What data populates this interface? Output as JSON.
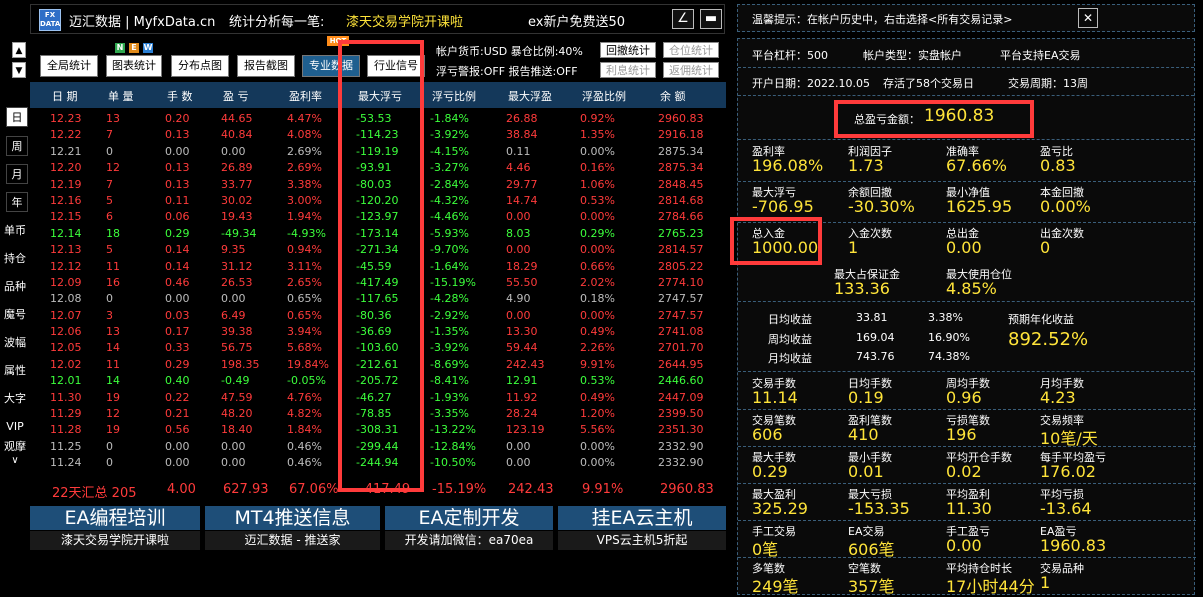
{
  "title_bar": {
    "brand": "迈汇数据 | MyfxData.cn",
    "slogan": "统计分析每一笔:",
    "promo": "漆天交易学院开课啦",
    "promo2": "ex新户免费送50",
    "min_icon": "∠",
    "close_icon": "▬"
  },
  "sidebar": {
    "arrow_up": "▲",
    "arrow_down": "▼",
    "nav": [
      "日",
      "周",
      "月",
      "年"
    ],
    "menu": [
      "单币",
      "持仓",
      "品种",
      "魔号",
      "波幅",
      "属性",
      "大字",
      "VIP",
      "观摩"
    ],
    "more": "∨"
  },
  "toolbar": {
    "buttons": [
      "全局统计",
      "图表统计",
      "分布点图",
      "报告截图",
      "专业数据",
      "行业信号"
    ],
    "new_badge": "NEW",
    "hot_badge": "HOT"
  },
  "account_info": {
    "line1": "帐户货币:USD 暴仓比例:40%",
    "line2": "浮亏警报:OFF 报告推送:OFF",
    "btn_withdraw": "回撤统计",
    "btn_position": "仓位统计",
    "btn_interest": "利息统计",
    "btn_rebate": "返佣统计"
  },
  "table": {
    "headers": [
      "日 期",
      "单 量",
      "手 数",
      "盈 亏",
      "盈利率",
      "最大浮亏",
      "浮亏比例",
      "最大浮盈",
      "浮盈比例",
      "余 额"
    ],
    "rows": [
      [
        "12.23",
        "13",
        "0.20",
        "44.65",
        "4.47%",
        "-53.53",
        "-1.84%",
        "26.88",
        "0.92%",
        "2960.83",
        "r"
      ],
      [
        "12.22",
        "7",
        "0.13",
        "40.84",
        "4.08%",
        "-114.23",
        "-3.92%",
        "38.84",
        "1.35%",
        "2916.18",
        "r"
      ],
      [
        "12.21",
        "0",
        "0.00",
        "0.00",
        "2.69%",
        "-119.19",
        "-4.15%",
        "0.11",
        "0.00%",
        "2875.34",
        "n"
      ],
      [
        "12.20",
        "12",
        "0.13",
        "26.89",
        "2.69%",
        "-93.91",
        "-3.27%",
        "4.46",
        "0.16%",
        "2875.34",
        "r"
      ],
      [
        "12.19",
        "7",
        "0.13",
        "33.77",
        "3.38%",
        "-80.03",
        "-2.84%",
        "29.77",
        "1.06%",
        "2848.45",
        "r"
      ],
      [
        "12.16",
        "5",
        "0.11",
        "30.02",
        "3.00%",
        "-120.20",
        "-4.32%",
        "14.74",
        "0.53%",
        "2814.68",
        "r"
      ],
      [
        "12.15",
        "6",
        "0.06",
        "19.43",
        "1.94%",
        "-123.97",
        "-4.46%",
        "0.00",
        "0.00%",
        "2784.66",
        "r"
      ],
      [
        "12.14",
        "18",
        "0.29",
        "-49.34",
        "-4.93%",
        "-173.14",
        "-5.93%",
        "8.03",
        "0.29%",
        "2765.23",
        "g"
      ],
      [
        "12.13",
        "5",
        "0.14",
        "9.35",
        "0.94%",
        "-271.34",
        "-9.70%",
        "0.00",
        "0.00%",
        "2814.57",
        "r"
      ],
      [
        "12.12",
        "11",
        "0.14",
        "31.12",
        "3.11%",
        "-45.59",
        "-1.64%",
        "18.29",
        "0.66%",
        "2805.22",
        "r"
      ],
      [
        "12.09",
        "16",
        "0.46",
        "26.53",
        "2.65%",
        "-417.49",
        "-15.19%",
        "55.50",
        "2.02%",
        "2774.10",
        "r"
      ],
      [
        "12.08",
        "0",
        "0.00",
        "0.00",
        "0.65%",
        "-117.65",
        "-4.28%",
        "4.90",
        "0.18%",
        "2747.57",
        "n"
      ],
      [
        "12.07",
        "3",
        "0.03",
        "6.49",
        "0.65%",
        "-80.36",
        "-2.92%",
        "0.00",
        "0.00%",
        "2747.57",
        "r"
      ],
      [
        "12.06",
        "13",
        "0.17",
        "39.38",
        "3.94%",
        "-36.69",
        "-1.35%",
        "13.30",
        "0.49%",
        "2741.08",
        "r"
      ],
      [
        "12.05",
        "14",
        "0.33",
        "56.75",
        "5.68%",
        "-103.60",
        "-3.92%",
        "59.44",
        "2.26%",
        "2701.70",
        "r"
      ],
      [
        "12.02",
        "11",
        "0.29",
        "198.35",
        "19.84%",
        "-212.61",
        "-8.69%",
        "242.43",
        "9.91%",
        "2644.95",
        "r"
      ],
      [
        "12.01",
        "14",
        "0.40",
        "-0.49",
        "-0.05%",
        "-205.72",
        "-8.41%",
        "12.91",
        "0.53%",
        "2446.60",
        "g"
      ],
      [
        "11.30",
        "19",
        "0.22",
        "47.59",
        "4.76%",
        "-46.27",
        "-1.93%",
        "11.92",
        "0.49%",
        "2447.09",
        "r"
      ],
      [
        "11.29",
        "12",
        "0.21",
        "48.20",
        "4.82%",
        "-78.85",
        "-3.35%",
        "28.24",
        "1.20%",
        "2399.50",
        "r"
      ],
      [
        "11.28",
        "19",
        "0.56",
        "18.40",
        "1.84%",
        "-308.31",
        "-13.22%",
        "123.19",
        "5.56%",
        "2351.30",
        "r"
      ],
      [
        "11.25",
        "0",
        "0.00",
        "0.00",
        "0.46%",
        "-299.44",
        "-12.84%",
        "0.00",
        "0.00%",
        "2332.90",
        "n"
      ],
      [
        "11.24",
        "0",
        "0.00",
        "0.00",
        "0.46%",
        "-244.94",
        "-10.50%",
        "0.00",
        "0.00%",
        "2332.90",
        "n"
      ]
    ],
    "summary": [
      "22天汇总 205",
      "4.00",
      "627.93",
      "67.06%",
      "-417.49",
      "-15.19%",
      "242.43",
      "9.91%",
      "2960.83"
    ]
  },
  "ads": [
    {
      "title": "EA编程培训",
      "sub": "漆天交易学院开课啦"
    },
    {
      "title": "MT4推送信息",
      "sub": "迈汇数据 - 推送家"
    },
    {
      "title": "EA定制开发",
      "sub": "开发请加微信：ea70ea"
    },
    {
      "title": "挂EA云主机",
      "sub": "VPS云主机5折起"
    }
  ],
  "right": {
    "tip": "温馨提示：在帐户历史中，右击选择<所有交易记录>",
    "close_icon": "✕",
    "leverage": "平台杠杆：500",
    "account_type": "帐户类型：实盘帐户",
    "ea_support": "平台支持EA交易",
    "open_date": "开户日期：2022.10.05",
    "survival": "存活了58个交易日",
    "cycle": "交易周期：13周",
    "total_pl_label": "总盈亏金额：",
    "total_pl": "1960.83",
    "grid1": [
      [
        "盈利率",
        "196.08%"
      ],
      [
        "利润因子",
        "1.73"
      ],
      [
        "准确率",
        "67.66%"
      ],
      [
        "盈亏比",
        "0.83"
      ],
      [
        "最大浮亏",
        "-706.95"
      ],
      [
        "余额回撤",
        "-30.30%"
      ],
      [
        "最小净值",
        "1625.95"
      ],
      [
        "本金回撤",
        "0.00%"
      ],
      [
        "总入金",
        "1000.00"
      ],
      [
        "入金次数",
        "1"
      ],
      [
        "总出金",
        "0.00"
      ],
      [
        "出金次数",
        "0"
      ]
    ],
    "margin": [
      [
        "最大占保证金",
        "133.36"
      ],
      [
        "最大使用仓位",
        "4.85%"
      ]
    ],
    "periodic": [
      [
        "日均收益",
        "33.81",
        "3.38%"
      ],
      [
        "周均收益",
        "169.04",
        "16.90%"
      ],
      [
        "月均收益",
        "743.76",
        "74.38%"
      ]
    ],
    "annual_label": "预期年化收益",
    "annual_value": "892.52%",
    "grid2": [
      [
        "交易手数",
        "11.14"
      ],
      [
        "日均手数",
        "0.19"
      ],
      [
        "周均手数",
        "0.96"
      ],
      [
        "月均手数",
        "4.23"
      ],
      [
        "交易笔数",
        "606"
      ],
      [
        "盈利笔数",
        "410"
      ],
      [
        "亏损笔数",
        "196"
      ],
      [
        "交易频率",
        "10笔/天"
      ],
      [
        "最大手数",
        "0.29"
      ],
      [
        "最小手数",
        "0.01"
      ],
      [
        "平均开仓手数",
        "0.02"
      ],
      [
        "每手平均盈亏",
        "176.02"
      ],
      [
        "最大盈利",
        "325.29"
      ],
      [
        "最大亏损",
        "-153.35"
      ],
      [
        "平均盈利",
        "11.30"
      ],
      [
        "平均亏损",
        "-13.64"
      ],
      [
        "手工交易",
        "0笔"
      ],
      [
        "EA交易",
        "606笔"
      ],
      [
        "手工盈亏",
        "0.00"
      ],
      [
        "EA盈亏",
        "1960.83"
      ],
      [
        "多笔数",
        "249笔"
      ],
      [
        "空笔数",
        "357笔"
      ],
      [
        "平均持仓时长",
        "17小时44分"
      ],
      [
        "交易品种",
        "1"
      ]
    ]
  },
  "colors": {
    "accent_red": "#ff3b3b",
    "green": "#3cff3c",
    "yellow": "#ffe43a",
    "header_blue": "#14385a"
  }
}
